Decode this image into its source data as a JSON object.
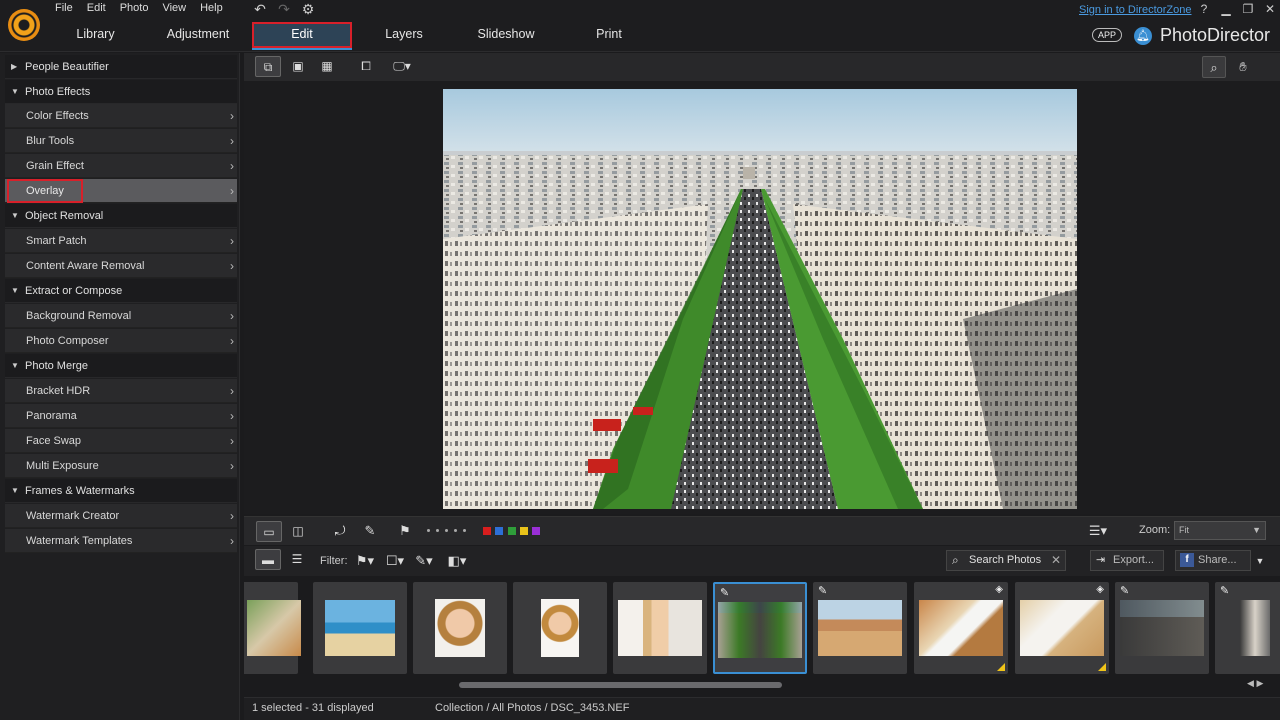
{
  "menu": [
    "File",
    "Edit",
    "Photo",
    "View",
    "Help"
  ],
  "tabs": [
    "Library",
    "Adjustment",
    "Edit",
    "Layers",
    "Slideshow",
    "Print"
  ],
  "active_tab": "Edit",
  "sign_in": "Sign in to DirectorZone",
  "help": "?",
  "app_badge": "APP",
  "brand": "PhotoDirector",
  "left_panel": {
    "people_beautifier": "People Beautifier",
    "photo_effects": "Photo Effects",
    "color_effects": "Color Effects",
    "blur_tools": "Blur Tools",
    "grain_effect": "Grain Effect",
    "overlay": "Overlay",
    "object_removal": "Object Removal",
    "smart_patch": "Smart Patch",
    "content_aware_removal": "Content Aware Removal",
    "extract_or_compose": "Extract or Compose",
    "background_removal": "Background Removal",
    "photo_composer": "Photo Composer",
    "photo_merge": "Photo Merge",
    "bracket_hdr": "Bracket HDR",
    "panorama": "Panorama",
    "face_swap": "Face Swap",
    "multi_exposure": "Multi Exposure",
    "frames_watermarks": "Frames & Watermarks",
    "watermark_creator": "Watermark Creator",
    "watermark_templates": "Watermark Templates"
  },
  "strip_toolbar": {
    "zoom_label": "Zoom:",
    "zoom_value": "Fit",
    "color_labels": [
      "#d81e1e",
      "#2d6fd6",
      "#2f9e3a",
      "#e8c21a",
      "#9a2fd6"
    ]
  },
  "filter_bar": {
    "filter_label": "Filter:",
    "search_label": "Search Photos",
    "export_label": "Export...",
    "share_label": "Share..."
  },
  "status": {
    "selection": "1 selected - 31 displayed",
    "path": "Collection / All Photos / DSC_3453.NEF"
  }
}
